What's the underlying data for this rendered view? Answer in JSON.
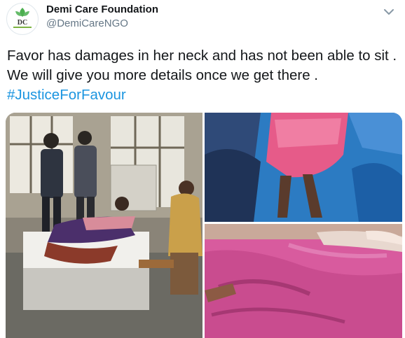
{
  "author": {
    "name": "Demi Care Foundation",
    "handle": "@DemiCareNGO",
    "avatar_initials": "DC"
  },
  "tweet": {
    "text": "Favor has damages in her neck and has not been able to sit . We will give you more details once we get there .",
    "hashtag": "#JusticeForFavour"
  },
  "icons": {
    "menu": "chevron-down-icon"
  },
  "colors": {
    "link": "#1b95e0",
    "handle": "#657786",
    "text": "#14171a"
  }
}
